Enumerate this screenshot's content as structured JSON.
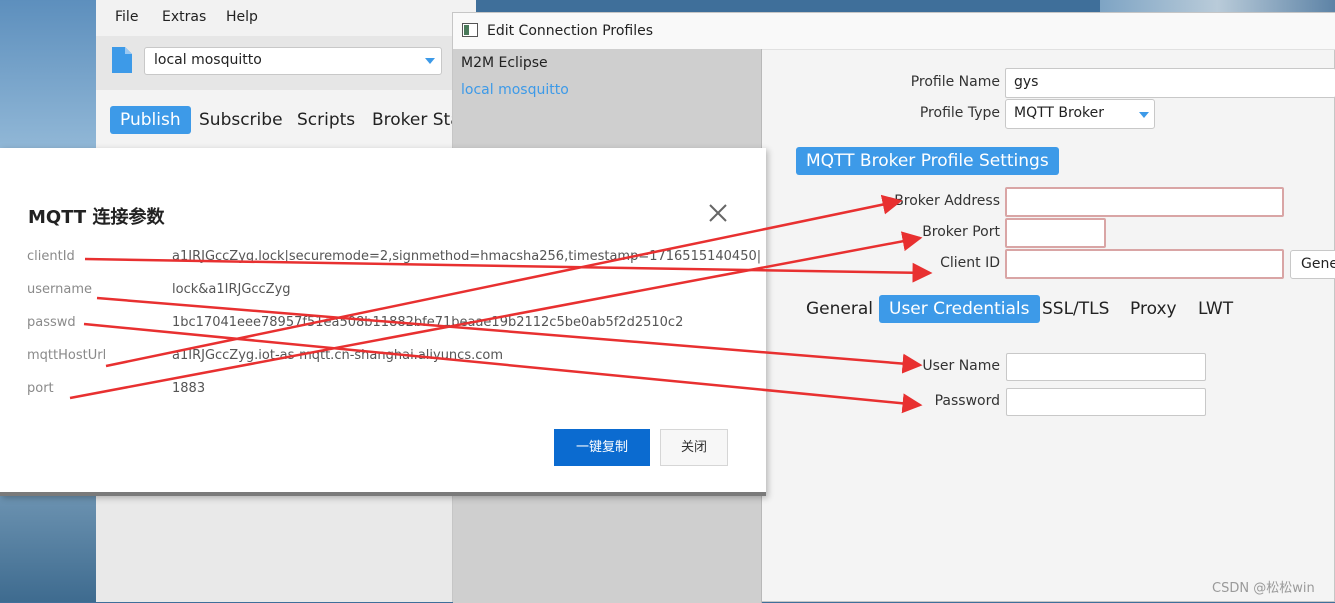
{
  "main_window": {
    "menu": [
      "File",
      "Extras",
      "Help"
    ],
    "profile_selected": "local mosquitto",
    "tabs": [
      {
        "label": "Publish",
        "active": true
      },
      {
        "label": "Subscribe",
        "active": false
      },
      {
        "label": "Scripts",
        "active": false
      },
      {
        "label": "Broker Sta",
        "active": false
      }
    ]
  },
  "edit_window": {
    "title": "Edit Connection Profiles",
    "profiles": [
      {
        "label": "M2M Eclipse",
        "selected": false
      },
      {
        "label": "local mosquitto",
        "selected": true
      }
    ],
    "form": {
      "profile_name_label": "Profile Name",
      "profile_name_value": "gys",
      "profile_type_label": "Profile Type",
      "profile_type_value": "MQTT Broker",
      "section_title": "MQTT Broker Profile Settings",
      "broker_address_label": "Broker Address",
      "broker_address_value": "",
      "broker_port_label": "Broker Port",
      "broker_port_value": "",
      "client_id_label": "Client ID",
      "client_id_value": "",
      "generate_label": "Gene",
      "subtabs": [
        {
          "label": "General",
          "active": false
        },
        {
          "label": "User Credentials",
          "active": true
        },
        {
          "label": "SSL/TLS",
          "active": false
        },
        {
          "label": "Proxy",
          "active": false
        },
        {
          "label": "LWT",
          "active": false
        }
      ],
      "user_name_label": "User Name",
      "user_name_value": "",
      "password_label": "Password",
      "password_value": ""
    }
  },
  "dialog": {
    "title": "MQTT 连接参数",
    "params": [
      {
        "key": "clientId",
        "value": "a1IRJGccZyg.lock|securemode=2,signmethod=hmacsha256,timestamp=1716515140450|"
      },
      {
        "key": "username",
        "value": "lock&a1IRJGccZyg"
      },
      {
        "key": "passwd",
        "value": "1bc17041eee78957f51ea508b11882bfe71beaae19b2112c5be0ab5f2d2510c2"
      },
      {
        "key": "mqttHostUrl",
        "value": "a1IRJGccZyg.iot-as-mqtt.cn-shanghai.aliyuncs.com"
      },
      {
        "key": "port",
        "value": "1883"
      }
    ],
    "copy_button": "一键复制",
    "close_button": "关闭"
  },
  "watermark": "CSDN @松松win",
  "colors": {
    "accent": "#3d9ae8",
    "arrow": "#e83030",
    "primary_button": "#0b6bd0"
  }
}
